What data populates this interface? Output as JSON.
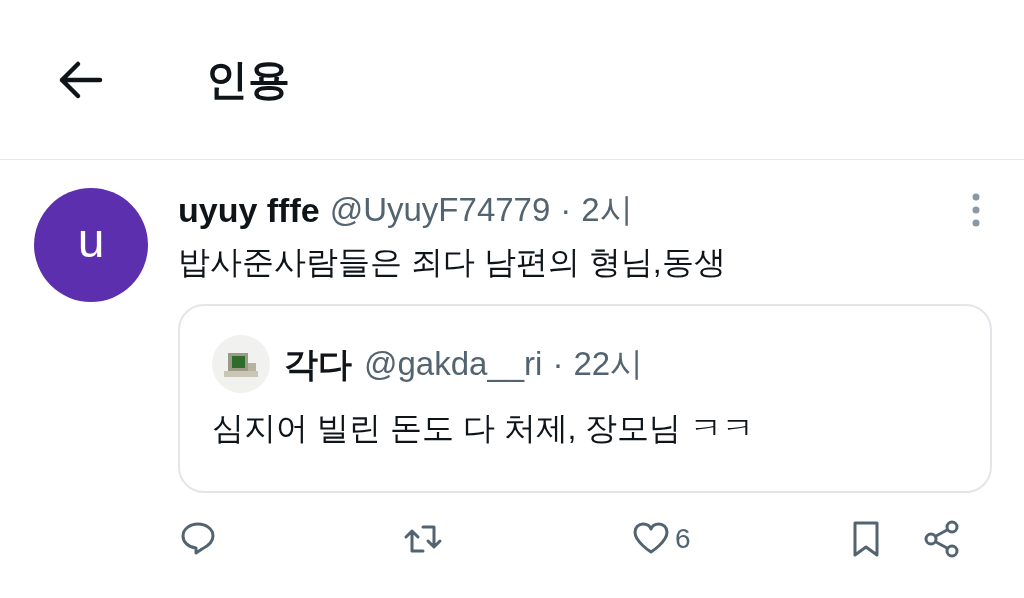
{
  "header": {
    "title": "인용"
  },
  "post": {
    "avatar_letter": "u",
    "display_name": "uyuy fffe",
    "handle": "@UyuyF74779",
    "separator": "·",
    "time": "2시",
    "text": "밥사준사람들은 죄다 남편의 형님,동생",
    "quote": {
      "display_name": "각다",
      "handle": "@gakda__ri",
      "separator": "·",
      "time": "22시",
      "text": "심지어 빌린 돈도 다 처제, 장모님 ㅋㅋ"
    },
    "actions": [
      {
        "kind": "reply"
      },
      {
        "kind": "repost"
      },
      {
        "kind": "like",
        "count": "6"
      },
      {
        "kind": "bookmark"
      },
      {
        "kind": "share"
      }
    ]
  }
}
